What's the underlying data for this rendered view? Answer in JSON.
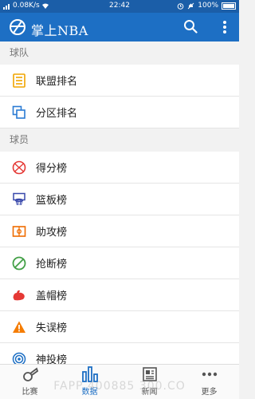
{
  "status_bar": {
    "network_speed": "0.08K/s",
    "time": "22:42",
    "battery": "100%",
    "battery_level": 1.0
  },
  "app_bar": {
    "title": "掌上NBA",
    "logo_icon": "basketball-icon",
    "search_icon": "search-icon",
    "more_icon": "more-vert-icon"
  },
  "sections": [
    {
      "header": "球队",
      "items": [
        {
          "label": "联盟排名",
          "icon": "list-icon",
          "color": "#f0a500"
        },
        {
          "label": "分区排名",
          "icon": "copy-icon",
          "color": "#2a7bd4"
        }
      ]
    },
    {
      "header": "球员",
      "items": [
        {
          "label": "得分榜",
          "icon": "basketball-icon",
          "color": "#e53935"
        },
        {
          "label": "篮板榜",
          "icon": "hoop-icon",
          "color": "#3949ab"
        },
        {
          "label": "助攻榜",
          "icon": "court-icon",
          "color": "#ef6c00"
        },
        {
          "label": "抢断榜",
          "icon": "block-icon",
          "color": "#43a047"
        },
        {
          "label": "盖帽榜",
          "icon": "muscle-icon",
          "color": "#e53935"
        },
        {
          "label": "失误榜",
          "icon": "warning-icon",
          "color": "#f57c00"
        },
        {
          "label": "神投榜",
          "icon": "target-icon",
          "color": "#1d6fc4"
        }
      ]
    }
  ],
  "bottom_nav": [
    {
      "label": "比赛",
      "icon": "whistle-icon",
      "active": false
    },
    {
      "label": "数据",
      "icon": "bar-chart-icon",
      "active": true
    },
    {
      "label": "新闻",
      "icon": "newspaper-icon",
      "active": false
    },
    {
      "label": "更多",
      "icon": "more-horiz-icon",
      "active": false
    }
  ],
  "watermark": "FAPP 400885 300.CO",
  "colors": {
    "status_bar": "#1b5ea8",
    "app_bar": "#1d6fc4",
    "accent": "#1d6fc4"
  }
}
